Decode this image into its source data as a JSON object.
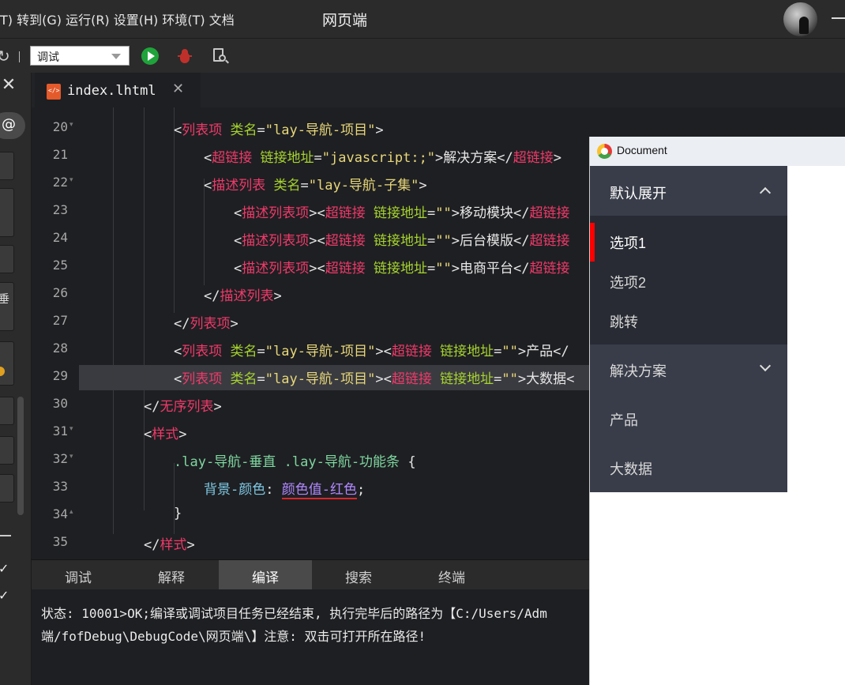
{
  "menubar": {
    "menu_text": "T) 转到(G) 运行(R) 设置(H) 环境(T) 文档",
    "app_title": "网页端"
  },
  "toolbar": {
    "mode_selected": "调试"
  },
  "sidebar": {
    "at_label": "@",
    "glyph": "垂"
  },
  "editor": {
    "tab_label": "index.lhtml",
    "lines": [
      {
        "num": "20",
        "fold": "▾"
      },
      {
        "num": "21",
        "fold": ""
      },
      {
        "num": "22",
        "fold": "▾"
      },
      {
        "num": "23",
        "fold": ""
      },
      {
        "num": "24",
        "fold": ""
      },
      {
        "num": "25",
        "fold": ""
      },
      {
        "num": "26",
        "fold": ""
      },
      {
        "num": "27",
        "fold": ""
      },
      {
        "num": "28",
        "fold": ""
      },
      {
        "num": "29",
        "fold": ""
      },
      {
        "num": "30",
        "fold": ""
      },
      {
        "num": "31",
        "fold": "▾"
      },
      {
        "num": "32",
        "fold": "▾"
      },
      {
        "num": "33",
        "fold": ""
      },
      {
        "num": "34",
        "fold": "▴"
      },
      {
        "num": "35",
        "fold": ""
      }
    ],
    "tokens": {
      "li": "列表项",
      "a": "超链接",
      "dl": "描述列表",
      "dd": "描述列表项",
      "ul": "无序列表",
      "style": "样式",
      "class_attr": "类名",
      "href_attr": "链接地址",
      "nav_item": "\"lay-导航-项目\"",
      "nav_child": "\"lay-导航-子集\"",
      "js_void": "\"javascript:;\"",
      "empty_str": "\"\"",
      "text_solution": "解决方案",
      "text_mobile": "移动模块",
      "text_backend": "后台模版",
      "text_ecom": "电商平台",
      "text_product": "产品",
      "text_bigdata": "大数据",
      "css_selector": ".lay-导航-垂直 .lay-导航-功能条",
      "css_prop": "背景-颜色",
      "css_value": "颜色值-红色"
    }
  },
  "bottom_panel": {
    "tabs": [
      "调试",
      "解释",
      "编译",
      "搜索",
      "终端"
    ],
    "active_tab": "编译",
    "output_line1": "状态: 10001>OK;编译或调试项目任务已经结束, 执行完毕后的路径为【C:/Users/Adm",
    "output_line2": "端/fofDebug\\DebugCode\\网页端\\】注意: 双击可打开所在路径!"
  },
  "preview": {
    "window_title": "Document",
    "nav": {
      "group1_title": "默认展开",
      "children": [
        "选项1",
        "选项2",
        "跳转"
      ],
      "group2_title": "解决方案",
      "item_product": "产品",
      "item_bigdata": "大数据"
    }
  },
  "colors": {
    "nav_bg": "#393d49",
    "nav_child_bg": "#282b33",
    "active_bar": "#ff0000",
    "tag": "#ee3a6a",
    "attr": "#a6d32f",
    "string": "#e8d77a"
  }
}
